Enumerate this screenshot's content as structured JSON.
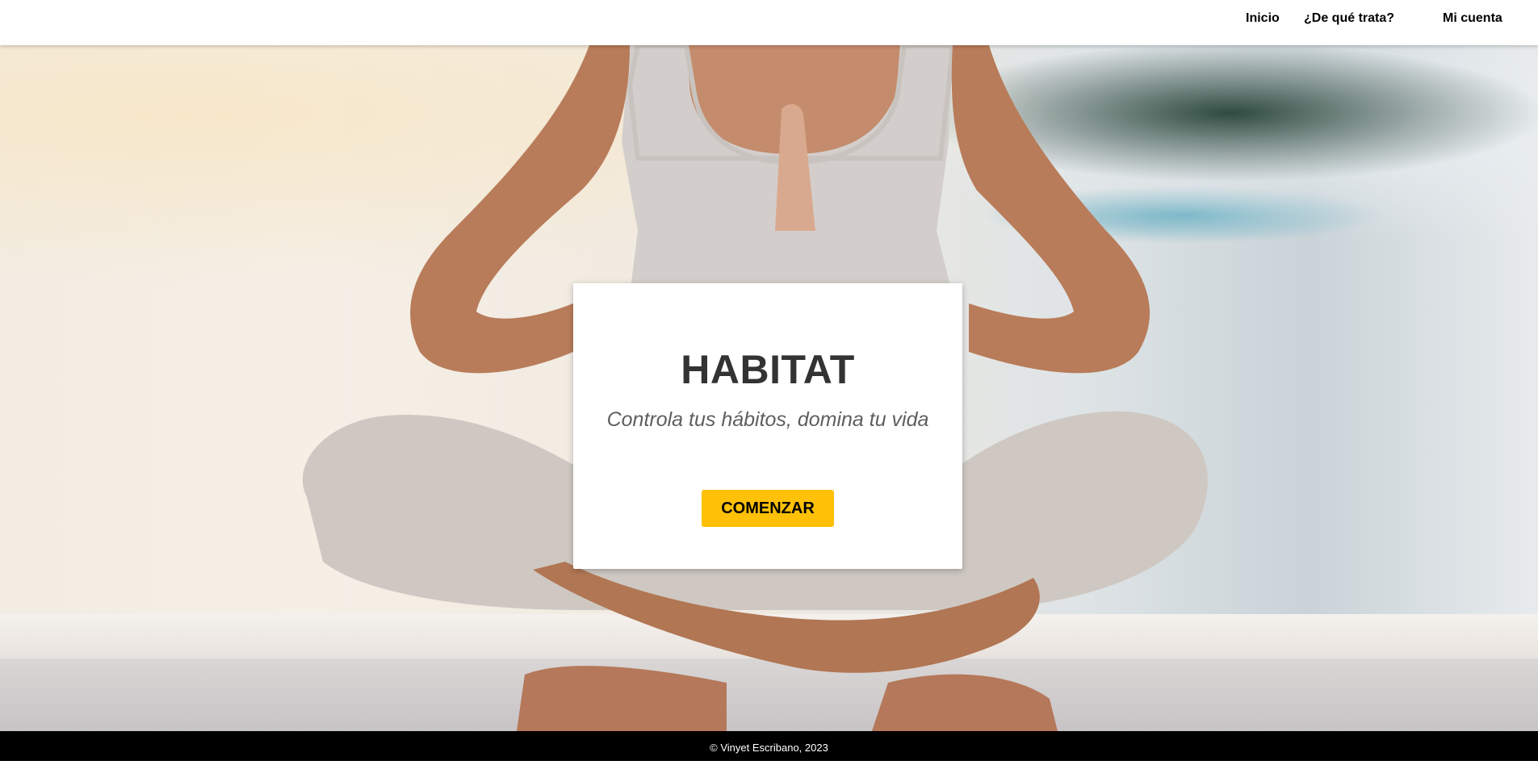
{
  "nav": {
    "items": [
      {
        "label": "Inicio"
      },
      {
        "label": "¿De qué trata?"
      },
      {
        "label": "Mi cuenta"
      }
    ]
  },
  "hero": {
    "image": "woman-meditating-lotus-pose-photo",
    "card": {
      "title": "HABITAT",
      "subtitle": "Controla tus hábitos, domina tu vida",
      "cta_label": "COMENZAR"
    }
  },
  "footer": {
    "text": "© Vinyet Escribano, 2023"
  },
  "colors": {
    "accent": "#ffc107",
    "title": "#333333",
    "footer_bg": "#000000"
  }
}
